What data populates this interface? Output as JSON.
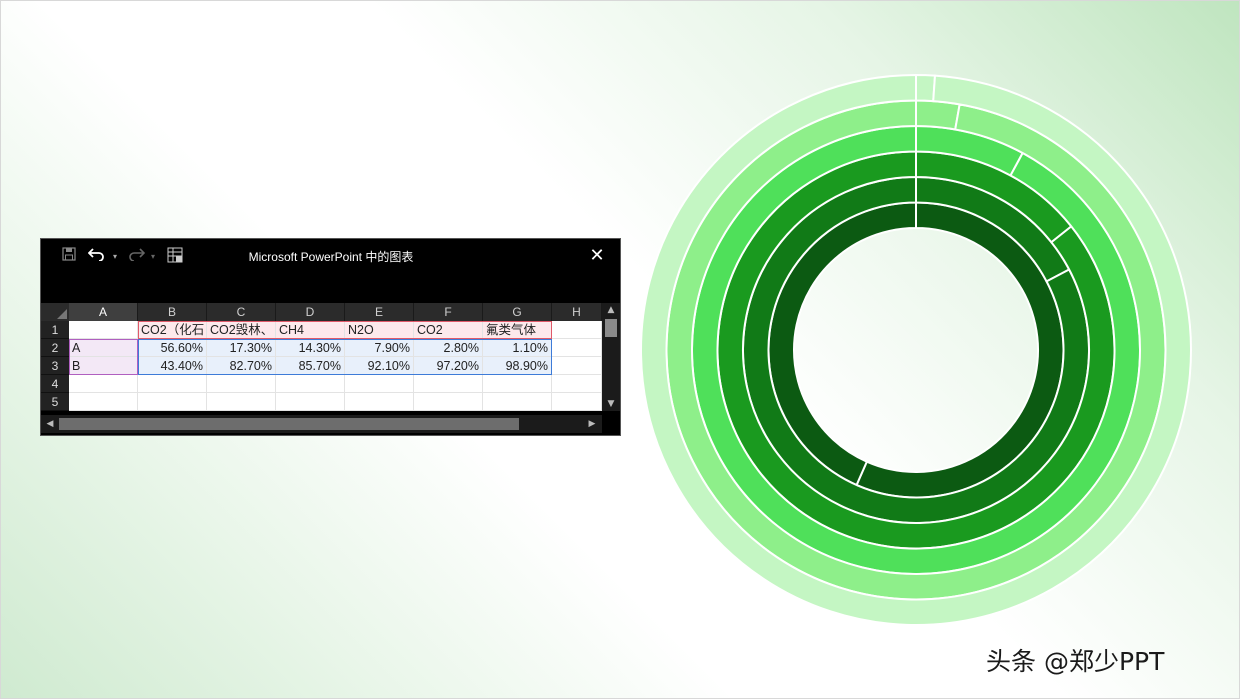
{
  "window": {
    "title": "Microsoft PowerPoint 中的图表",
    "toolbar_icons": [
      "save-icon",
      "undo-icon",
      "redo-icon",
      "edit-data-icon"
    ],
    "close_label": "✕"
  },
  "sheet": {
    "column_headers": [
      "A",
      "B",
      "C",
      "D",
      "E",
      "F",
      "G",
      "H"
    ],
    "row_headers": [
      "1",
      "2",
      "3",
      "4",
      "5"
    ],
    "rows": [
      [
        "",
        "CO2（化石",
        "CO2毁林、",
        "CH4",
        "N2O",
        "CO2",
        "氟类气体",
        ""
      ],
      [
        "A",
        "56.60%",
        "17.30%",
        "14.30%",
        "7.90%",
        "2.80%",
        "1.10%",
        ""
      ],
      [
        "B",
        "43.40%",
        "82.70%",
        "85.70%",
        "92.10%",
        "97.20%",
        "98.90%",
        ""
      ],
      [
        "",
        "",
        "",
        "",
        "",
        "",
        "",
        ""
      ],
      [
        "",
        "",
        "",
        "",
        "",
        "",
        "",
        ""
      ]
    ]
  },
  "chart_data": {
    "type": "doughnut",
    "categories": [
      "A",
      "B"
    ],
    "series": [
      {
        "name": "CO2（化石",
        "values": [
          56.6,
          43.4
        ]
      },
      {
        "name": "CO2毁林、",
        "values": [
          17.3,
          82.7
        ]
      },
      {
        "name": "CH4",
        "values": [
          14.3,
          85.7
        ]
      },
      {
        "name": "N2O",
        "values": [
          7.9,
          92.1
        ]
      },
      {
        "name": "CO2",
        "values": [
          2.8,
          97.2
        ]
      },
      {
        "name": "氟类气体",
        "values": [
          1.1,
          98.9
        ]
      }
    ],
    "ring_colors": [
      "#0c5a12",
      "#117a17",
      "#1a9a1f",
      "#4fe05a",
      "#8eef8a",
      "#c4f6c3"
    ],
    "divider_color": "#ffffff"
  },
  "watermark": "头条 @郑少PPT"
}
